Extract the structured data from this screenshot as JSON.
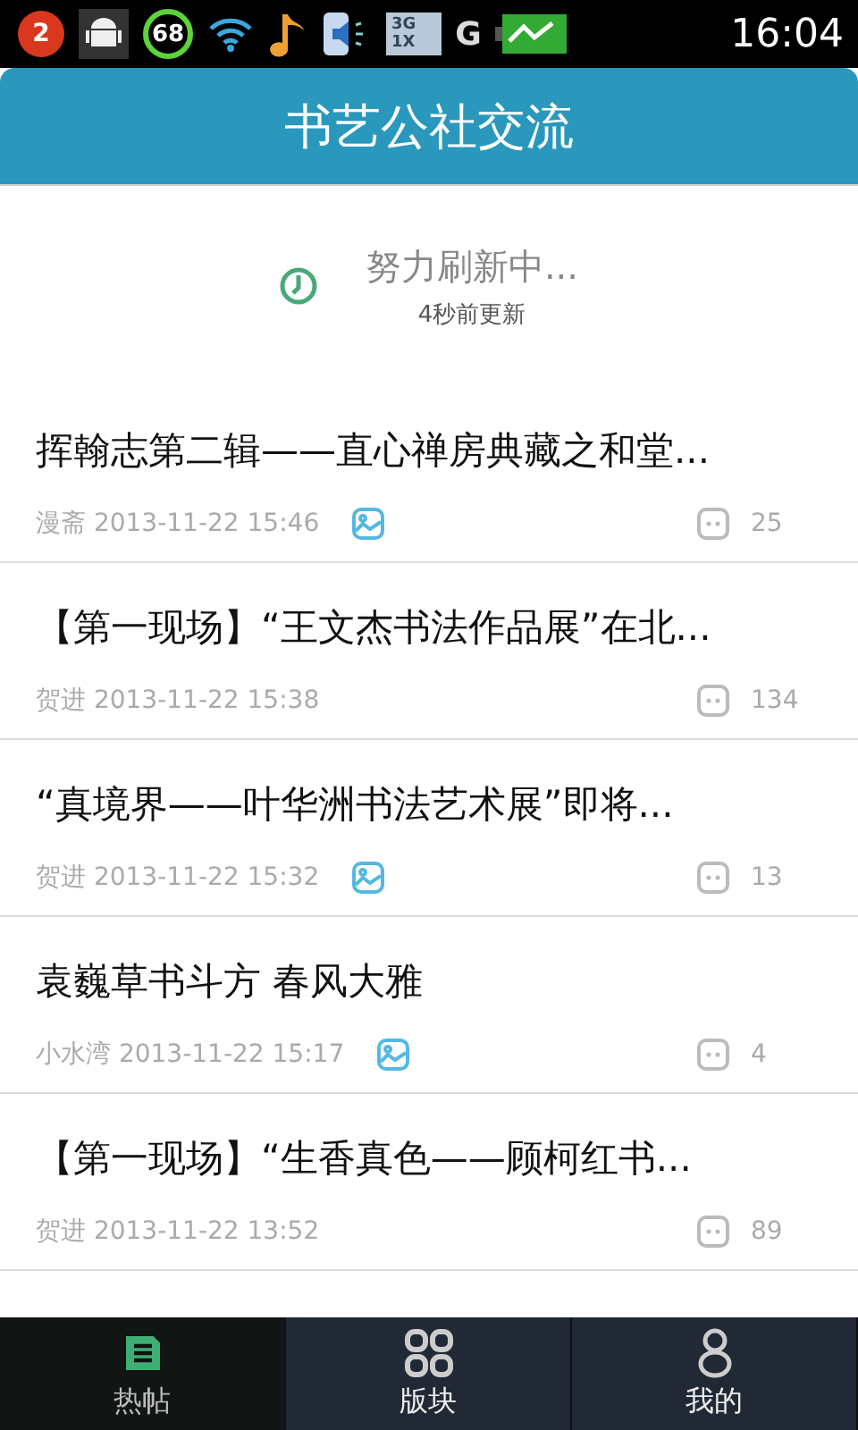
{
  "status_bar": {
    "notification_count": "2",
    "battery_saver": "68",
    "network_top": "3G",
    "network_bottom": "1X",
    "signal_label": "G",
    "time": "16:04"
  },
  "header": {
    "title": "书艺公社交流"
  },
  "refresh": {
    "status": "努力刷新中...",
    "updated": "4秒前更新"
  },
  "posts": [
    {
      "title": "挥翰志第二辑——直心禅房典藏之和堂...",
      "author": "漫斋",
      "time": "2013-11-22 15:46",
      "has_image": true,
      "comments": "25"
    },
    {
      "title": "【第一现场】“王文杰书法作品展”在北...",
      "author": "贺进",
      "time": "2013-11-22 15:38",
      "has_image": false,
      "comments": "134"
    },
    {
      "title": "“真境界——叶华洲书法艺术展”即将...",
      "author": "贺进",
      "time": "2013-11-22 15:32",
      "has_image": true,
      "comments": "13"
    },
    {
      "title": "袁巍草书斗方 春风大雅",
      "author": "小水湾",
      "time": "2013-11-22 15:17",
      "has_image": true,
      "comments": "4"
    },
    {
      "title": "【第一现场】“生香真色——顾柯红书...",
      "author": "贺进",
      "time": "2013-11-22 13:52",
      "has_image": false,
      "comments": "89"
    }
  ],
  "tabs": [
    {
      "label": "热帖",
      "kind": "posts",
      "selected": true
    },
    {
      "label": "版块",
      "kind": "boards",
      "selected": false
    },
    {
      "label": "我的",
      "kind": "profile",
      "selected": false
    }
  ]
}
